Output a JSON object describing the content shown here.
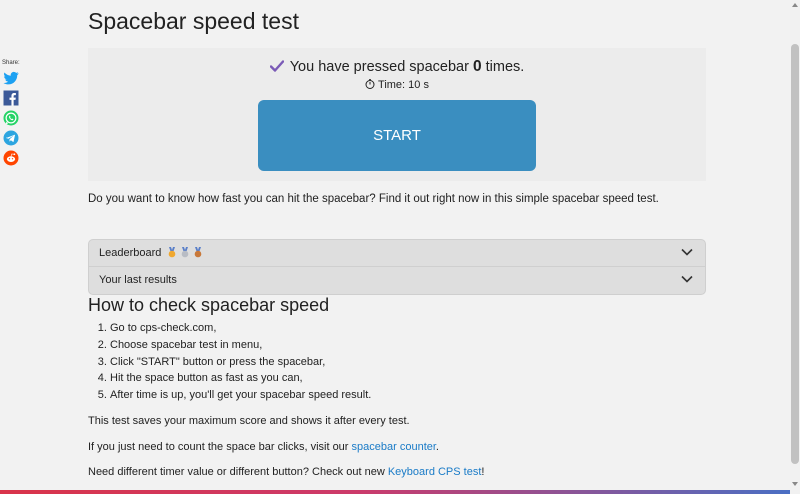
{
  "page_title": "Spacebar speed test",
  "share": {
    "label": "Share:",
    "icons": [
      "twitter-icon",
      "facebook-icon",
      "whatsapp-icon",
      "telegram-icon",
      "reddit-icon"
    ]
  },
  "test": {
    "counter_prefix": "You have pressed spacebar",
    "count": "0",
    "counter_suffix": "times.",
    "time_label": "Time: 10 s",
    "start_label": "START"
  },
  "intro": "Do you want to know how fast you can hit the spacebar? Find it out right now in this simple spacebar speed test.",
  "accordion": {
    "leaderboard_label": "Leaderboard",
    "last_results_label": "Your last results"
  },
  "how_to": {
    "title": "How to check spacebar speed",
    "steps": [
      "Go to cps-check.com,",
      "Choose spacebar test in menu,",
      "Click \"START\" button or press the spacebar,",
      "Hit the space button as fast as you can,",
      "After time is up, you'll get your spacebar speed result."
    ]
  },
  "notes": {
    "save": "This test saves your maximum score and shows it after every test.",
    "counter_prefix": "If you just need to count the space bar clicks, visit our",
    "counter_link": "spacebar counter",
    "counter_suffix": ".",
    "cps_prefix": "Need different timer value or different button? Check out new",
    "cps_link": "Keyboard CPS test",
    "cps_suffix": "!"
  },
  "colors": {
    "start_button": "#3a8ec0",
    "link": "#1a7bc7",
    "check": "#7b5bb7",
    "twitter": "#1da1f2",
    "facebook": "#3b5998",
    "whatsapp": "#25d366",
    "telegram": "#2ca5e0",
    "reddit": "#ff4500"
  }
}
